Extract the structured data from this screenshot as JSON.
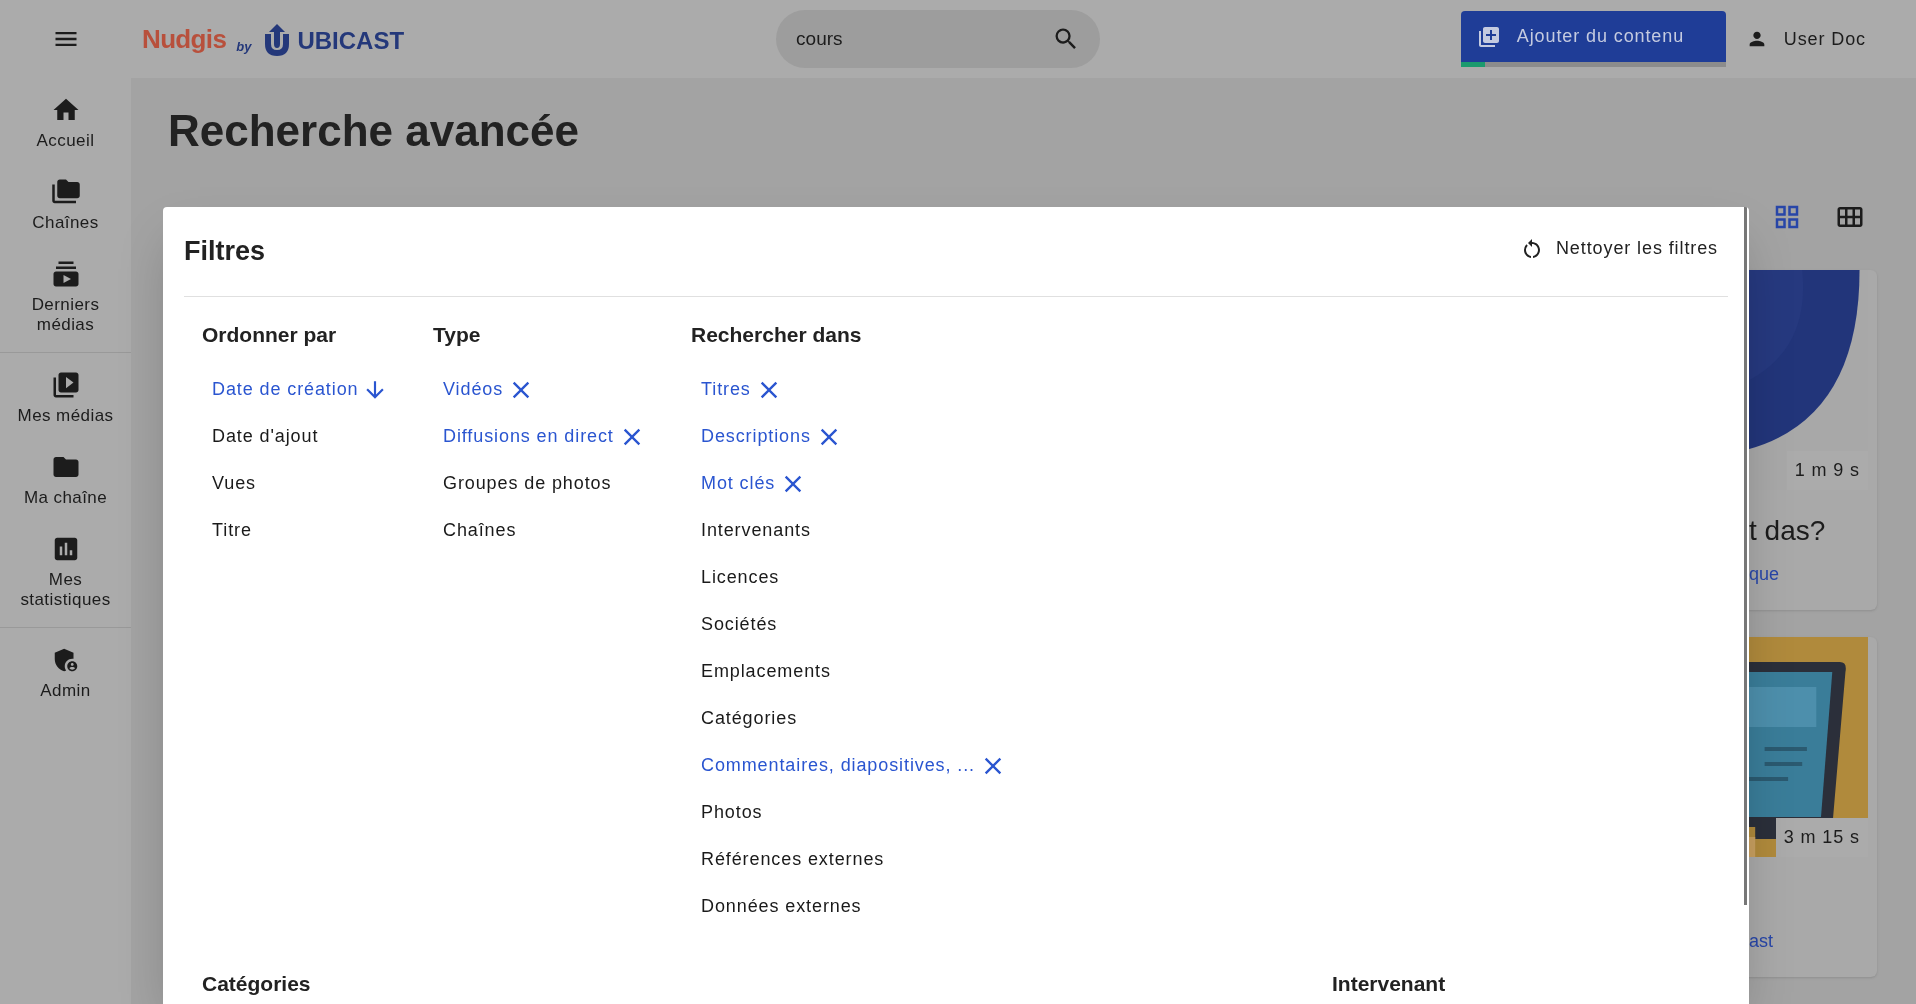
{
  "header": {
    "logo": {
      "brand": "Nudgis",
      "by": "by",
      "company": "UBICAST"
    },
    "search": {
      "value": "cours"
    },
    "add_button": {
      "label": "Ajouter du contenu",
      "level": 0.09
    },
    "user": {
      "name": "User Doc"
    }
  },
  "sidebar": {
    "groups": [
      {
        "items": [
          {
            "label": "Accueil"
          },
          {
            "label": "Chaînes"
          },
          {
            "label": "Derniers médias"
          }
        ]
      },
      {
        "items": [
          {
            "label": "Mes médias"
          },
          {
            "label": "Ma chaîne"
          },
          {
            "label": "Mes statistiques"
          }
        ]
      },
      {
        "items": [
          {
            "label": "Admin"
          }
        ]
      }
    ]
  },
  "page": {
    "title": "Recherche avancée",
    "views": [
      {
        "kind": "grid",
        "selected": true
      },
      {
        "kind": "table",
        "selected": false
      }
    ],
    "cards": [
      {
        "duration": "1 m 9 s",
        "title": "t das?",
        "link": "que"
      },
      {
        "duration": "3 m 15 s",
        "link": "ast"
      }
    ]
  },
  "filters": {
    "title": "Filtres",
    "clear_button": "Nettoyer les filtres",
    "columns": [
      {
        "heading": "Ordonner par",
        "kind": "sort",
        "options": [
          {
            "label": "Date de création",
            "selected": true
          },
          {
            "label": "Date d'ajout",
            "selected": false
          },
          {
            "label": "Vues",
            "selected": false
          },
          {
            "label": "Titre",
            "selected": false
          }
        ]
      },
      {
        "heading": "Type",
        "kind": "toggle",
        "options": [
          {
            "label": "Vidéos",
            "selected": true
          },
          {
            "label": "Diffusions en direct",
            "selected": true
          },
          {
            "label": "Groupes de photos",
            "selected": false
          },
          {
            "label": "Chaînes",
            "selected": false
          }
        ]
      },
      {
        "heading": "Rechercher dans",
        "kind": "toggle",
        "options": [
          {
            "label": "Titres",
            "selected": true
          },
          {
            "label": "Descriptions",
            "selected": true
          },
          {
            "label": "Mot clés",
            "selected": true
          },
          {
            "label": "Intervenants",
            "selected": false
          },
          {
            "label": "Licences",
            "selected": false
          },
          {
            "label": "Sociétés",
            "selected": false
          },
          {
            "label": "Emplacements",
            "selected": false
          },
          {
            "label": "Catégories",
            "selected": false
          },
          {
            "label": "Commentaires, diapositives, ...",
            "selected": true
          },
          {
            "label": "Photos",
            "selected": false
          },
          {
            "label": "Références externes",
            "selected": false
          },
          {
            "label": "Données externes",
            "selected": false
          }
        ]
      }
    ],
    "sections": [
      {
        "heading": "Catégories"
      },
      {
        "heading": "Intervenant"
      }
    ]
  }
}
